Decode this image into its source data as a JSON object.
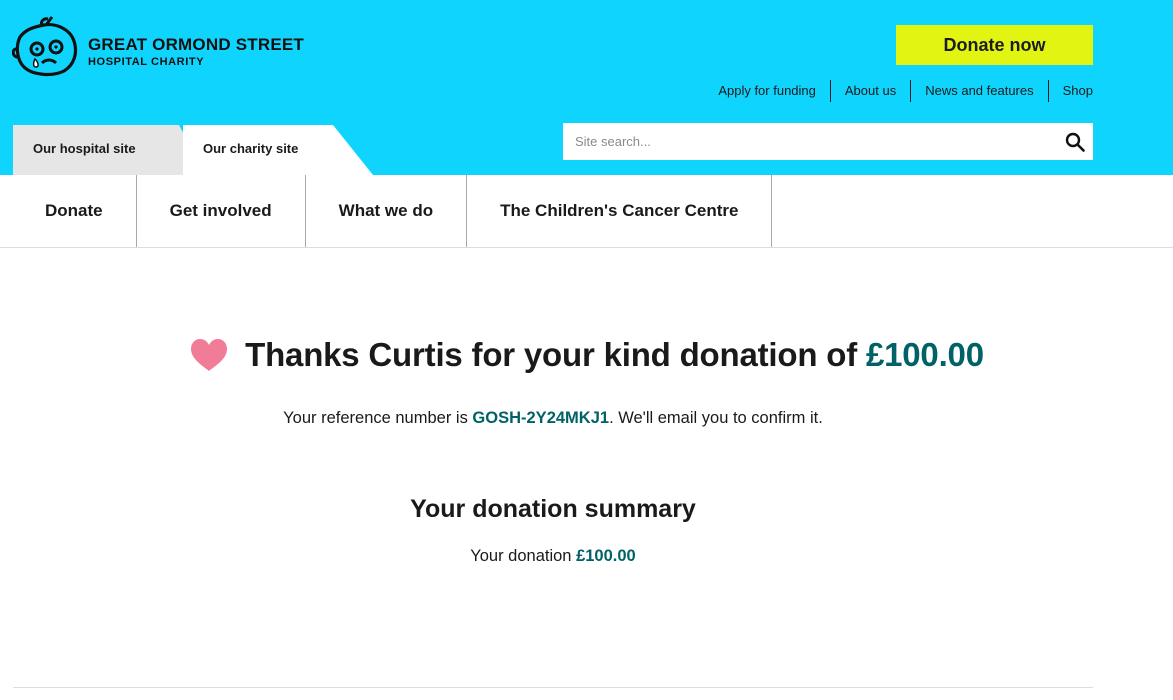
{
  "logo": {
    "title": "GREAT ORMOND STREET",
    "subtitle": "HOSPITAL CHARITY"
  },
  "header": {
    "donate_now_label": "Donate now",
    "utility_links": [
      "Apply for funding",
      "About us",
      "News and features",
      "Shop"
    ],
    "tabs": {
      "hospital": "Our hospital site",
      "charity": "Our charity site"
    },
    "search": {
      "placeholder": "Site search...",
      "value": "",
      "icon": "search-icon"
    }
  },
  "main_nav": [
    "Donate",
    "Get involved",
    "What we do",
    "The Children's Cancer Centre"
  ],
  "thanks": {
    "text": "Thanks Curtis for your kind donation of ",
    "amount": "£100.00",
    "icon": "heart-icon"
  },
  "reference": {
    "prefix": "Your reference number is ",
    "number": "GOSH-2Y24MKJ1",
    "suffix": ". We'll email you to confirm it."
  },
  "summary": {
    "title": "Your donation summary",
    "label": "Your donation ",
    "amount": "£100.00"
  },
  "colors": {
    "header_bg": "#0fd5fe",
    "donate_button": "#e2f411",
    "accent_teal": "#006167",
    "heart": "#f07c98"
  }
}
